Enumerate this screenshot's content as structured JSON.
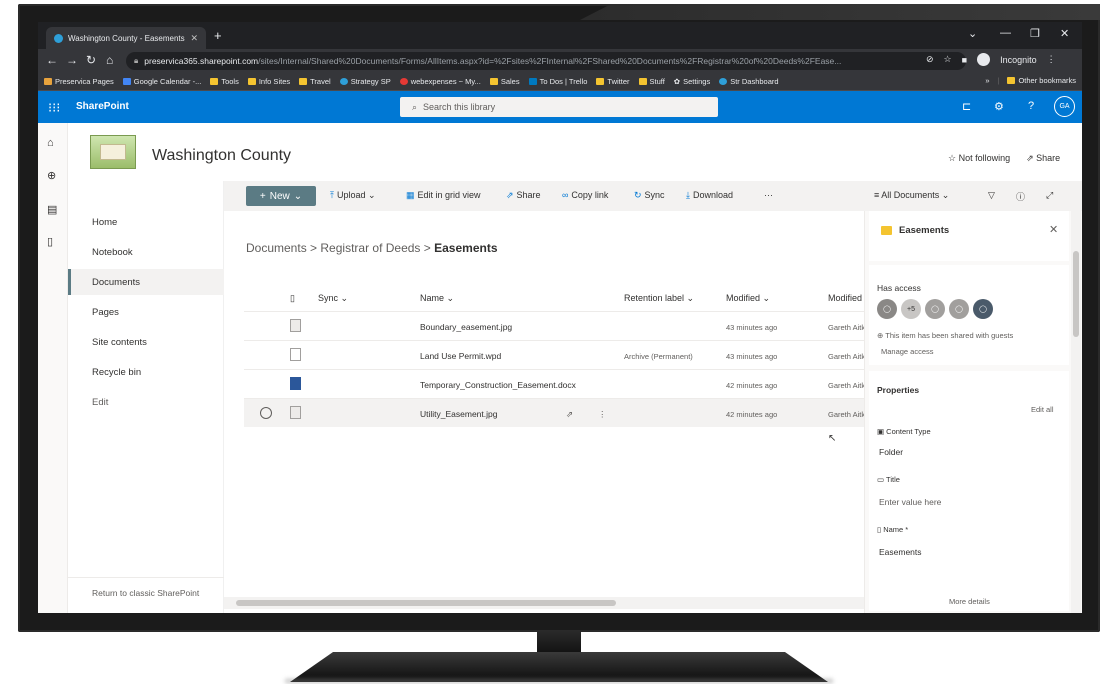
{
  "browser": {
    "tab_title": "Washington County - Easements",
    "url_host": "preservica365.sharepoint.com",
    "url_path": "/sites/Internal/Shared%20Documents/Forms/AllItems.aspx?id=%2Fsites%2FInternal%2FShared%20Documents%2FRegistrar%20of%20Deeds%2FEase...",
    "incognito_label": "Incognito",
    "bookmarks": [
      "Preservica Pages",
      "Google Calendar -...",
      "Tools",
      "Info Sites",
      "Travel",
      "Strategy SP",
      "webexpenses ~ My...",
      "Sales",
      "To Dos | Trello",
      "Twitter",
      "Stuff",
      "Settings",
      "Str Dashboard"
    ],
    "other_bookmarks": "Other bookmarks",
    "more_bookmarks": "»"
  },
  "suite": {
    "app_name": "SharePoint",
    "search_placeholder": "Search this library",
    "user_initials": "GA"
  },
  "site": {
    "title": "Washington County",
    "follow_label": "Not following",
    "share_label": "Share"
  },
  "nav": {
    "items": [
      "Home",
      "Notebook",
      "Documents",
      "Pages",
      "Site contents",
      "Recycle bin",
      "Edit"
    ],
    "selected": "Documents",
    "footer": "Return to classic SharePoint"
  },
  "commands": {
    "new": "New",
    "upload": "Upload",
    "grid": "Edit in grid view",
    "share": "Share",
    "copy_link": "Copy link",
    "sync": "Sync",
    "download": "Download",
    "more": "···",
    "view": "All Documents"
  },
  "breadcrumb": {
    "root": "Documents",
    "mid": "Registrar of Deeds",
    "current": "Easements"
  },
  "table": {
    "columns": [
      "Sync",
      "Name",
      "Retention label",
      "Modified",
      "Modified"
    ],
    "rows": [
      {
        "name": "Boundary_easement.jpg",
        "retention": "",
        "modified": "43 minutes ago",
        "by": "Gareth Aitk"
      },
      {
        "name": "Land Use Permit.wpd",
        "retention": "Archive (Permanent)",
        "modified": "43 minutes ago",
        "by": "Gareth Aitk"
      },
      {
        "name": "Temporary_Construction_Easement.docx",
        "retention": "",
        "modified": "42 minutes ago",
        "by": "Gareth Aitk"
      },
      {
        "name": "Utility_Easement.jpg",
        "retention": "",
        "modified": "42 minutes ago",
        "by": "Gareth Aitk"
      }
    ]
  },
  "details": {
    "title": "Easements",
    "has_access": "Has access",
    "shared_note": "This item has been shared with guests",
    "manage": "Manage access",
    "properties": "Properties",
    "edit_all": "Edit all",
    "content_type_label": "Content Type",
    "content_type_value": "Folder",
    "title_label": "Title",
    "title_placeholder": "Enter value here",
    "name_label": "Name *",
    "name_value": "Easements",
    "more_details": "More details",
    "access_count": "+5"
  },
  "colors": {
    "suite_blue": "#0078d4",
    "new_button": "#5b7b84",
    "folder": "#f4c430"
  }
}
